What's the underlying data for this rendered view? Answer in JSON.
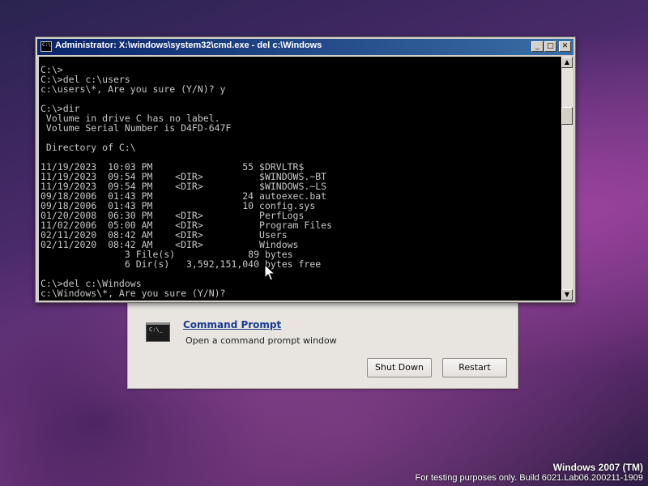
{
  "window": {
    "title": "Administrator: X:\\windows\\system32\\cmd.exe - del  c:\\Windows",
    "icon_label": "C:\\",
    "minimize": "_",
    "maximize": "□",
    "close": "✕"
  },
  "console": {
    "lines": [
      "C:\\>",
      "C:\\>del c:\\users",
      "c:\\users\\*, Are you sure (Y/N)? y",
      "",
      "C:\\>dir",
      " Volume in drive C has no label.",
      " Volume Serial Number is D4FD-647F",
      "",
      " Directory of C:\\",
      "",
      "11/19/2023  10:03 PM                55 $DRVLTR$",
      "11/19/2023  09:54 PM    <DIR>          $WINDOWS.~BT",
      "11/19/2023  09:54 PM    <DIR>          $WINDOWS.~LS",
      "09/18/2006  01:43 PM                24 autoexec.bat",
      "09/18/2006  01:43 PM                10 config.sys",
      "01/20/2008  06:30 PM    <DIR>          PerfLogs",
      "11/02/2006  05:00 AM    <DIR>          Program Files",
      "02/11/2020  08:42 AM    <DIR>          Users",
      "02/11/2020  08:42 AM    <DIR>          Windows",
      "               3 File(s)             89 bytes",
      "               6 Dir(s)   3,592,151,040 bytes free",
      "",
      "C:\\>del c:\\Windows",
      "c:\\Windows\\*, Are you sure (Y/N)?"
    ]
  },
  "scrollbar": {
    "up": "▲",
    "down": "▼"
  },
  "recovery": {
    "icon_label": "C:\\_",
    "link": "Command Prompt",
    "description": "Open a command prompt window",
    "shutdown": "Shut Down",
    "restart": "Restart"
  },
  "branding": {
    "title": "Windows 2007 (TM)",
    "subtitle": "For testing purposes only. Build 6021.Lab06.200211-1909"
  }
}
